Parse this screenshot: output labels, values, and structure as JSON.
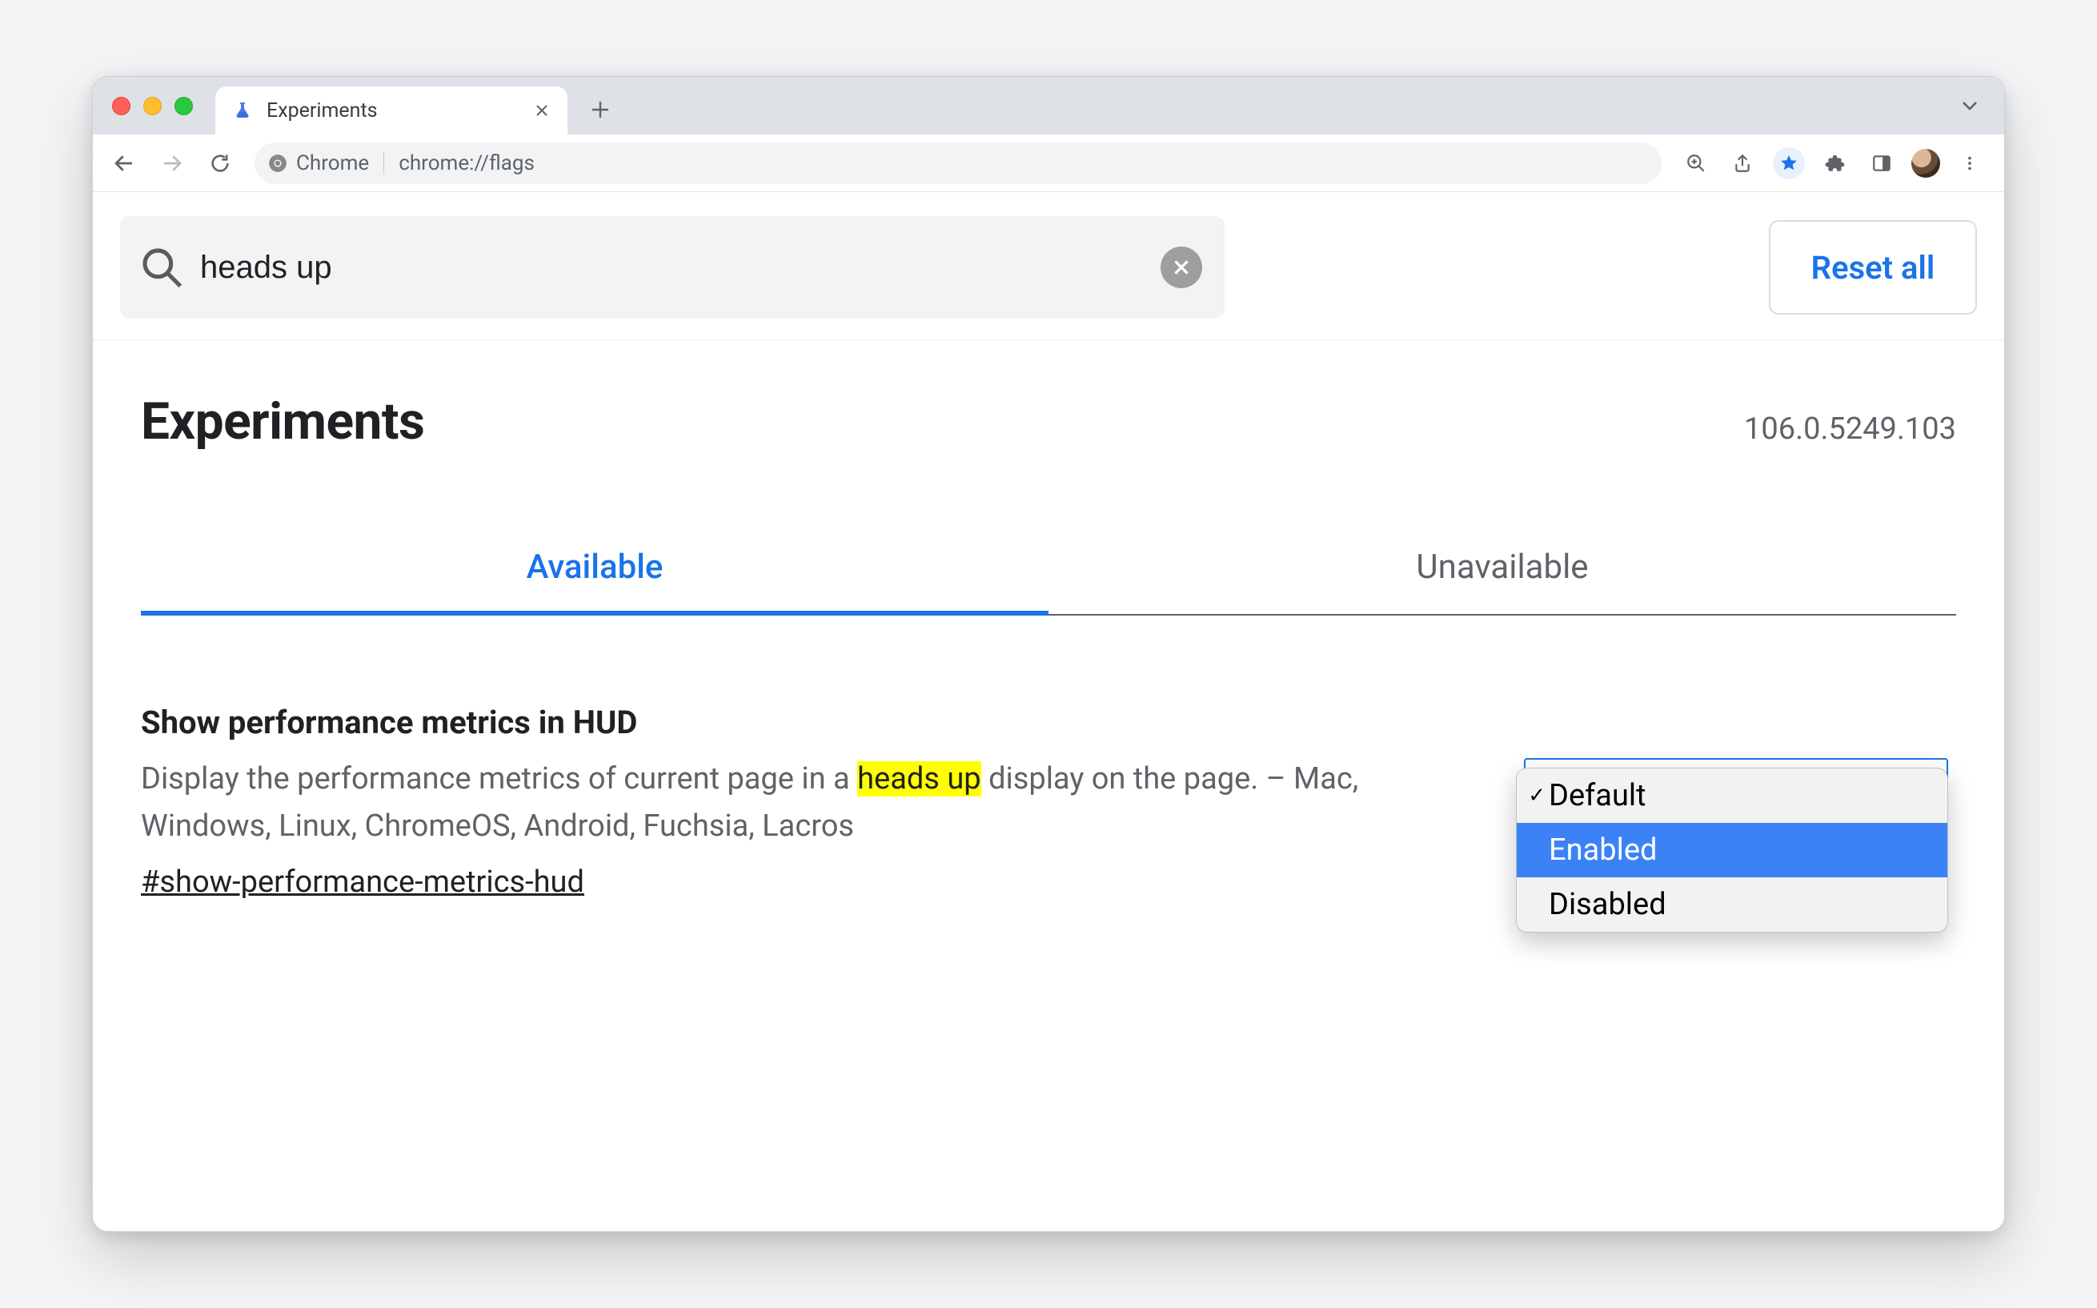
{
  "browser": {
    "tab_title": "Experiments",
    "omnibox_chip": "Chrome",
    "omnibox_url": "chrome://flags"
  },
  "search": {
    "query": "heads up",
    "reset_label": "Reset all"
  },
  "page": {
    "heading": "Experiments",
    "version": "106.0.5249.103"
  },
  "tabs": {
    "available": "Available",
    "unavailable": "Unavailable",
    "active": "available"
  },
  "experiment": {
    "title": "Show performance metrics in HUD",
    "desc_before": "Display the performance metrics of current page in a ",
    "desc_highlight": "heads up",
    "desc_after": " display on the page. – Mac, Windows, Linux, ChromeOS, Android, Fuchsia, Lacros",
    "anchor": "#show-performance-metrics-hud",
    "options": {
      "default": "Default",
      "enabled": "Enabled",
      "disabled": "Disabled",
      "current": "Default",
      "hovered": "Enabled"
    }
  }
}
